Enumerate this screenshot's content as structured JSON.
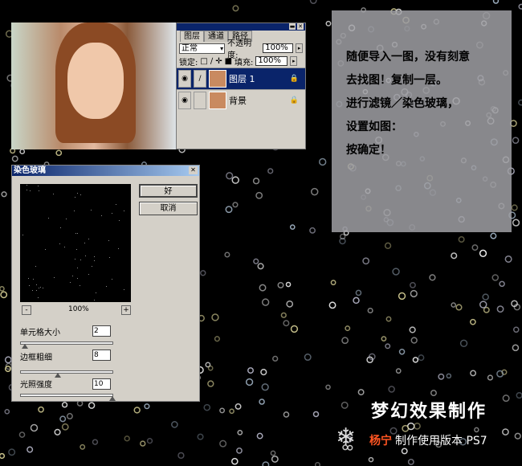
{
  "layers_panel": {
    "tabs": [
      "图层",
      "通道",
      "路径"
    ],
    "blend_mode": "正常",
    "opacity_label": "不透明度:",
    "opacity": "100%",
    "lock_label": "锁定:",
    "fill_label": "填充:",
    "fill": "100%",
    "layers": [
      {
        "name": "图层 1",
        "selected": true
      },
      {
        "name": "背景",
        "selected": false
      }
    ]
  },
  "dialog": {
    "title": "染色玻璃",
    "ok": "好",
    "cancel": "取消",
    "zoom": "100%",
    "zoom_out": "-",
    "zoom_in": "+",
    "params": [
      {
        "label": "单元格大小",
        "value": "2",
        "slider_fraction": 0.04
      },
      {
        "label": "边框粗细",
        "value": "8",
        "slider_fraction": 0.4
      },
      {
        "label": "光照强度",
        "value": "10",
        "slider_fraction": 1.0
      }
    ]
  },
  "note": {
    "lines": [
      "随便导入一图，没有刻意",
      "去找图！复制一层。",
      "进行滤镜／染色玻璃，",
      "设置如图：",
      "按确定！"
    ]
  },
  "footer": {
    "title": "梦幻效果制作",
    "author": "杨宁",
    "subtitle": "制作使用版本 PS7"
  }
}
